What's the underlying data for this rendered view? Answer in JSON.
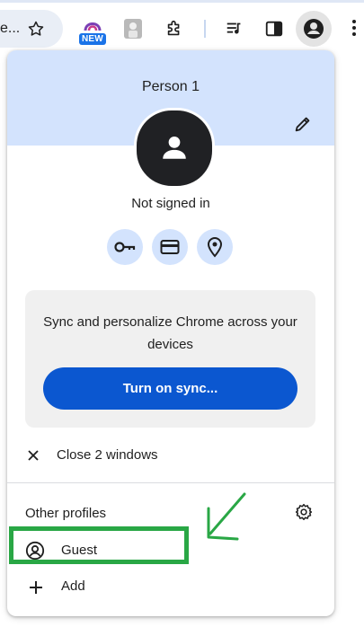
{
  "toolbar": {
    "omnibox_text": "e...",
    "new_badge": "NEW"
  },
  "panel": {
    "profile_name": "Person 1",
    "signin_status": "Not signed in",
    "sync_message": "Sync and personalize Chrome across your devices",
    "sync_button": "Turn on sync...",
    "close_windows": "Close 2 windows",
    "other_profiles_title": "Other profiles",
    "guest_label": "Guest",
    "add_label": "Add"
  },
  "colors": {
    "header_bg": "#d3e3fd",
    "sync_button_bg": "#0b57d0",
    "highlight": "#29a745"
  }
}
